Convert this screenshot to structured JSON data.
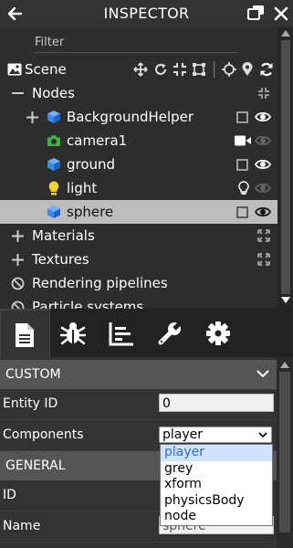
{
  "header": {
    "title": "INSPECTOR"
  },
  "tree": {
    "filter_placeholder": "Filter",
    "scene_label": "Scene",
    "nodes_label": "Nodes",
    "items": [
      {
        "label": "BackgroundHelper",
        "icon": "box-icon"
      },
      {
        "label": "camera1",
        "icon": "camera-icon"
      },
      {
        "label": "ground",
        "icon": "box-icon"
      },
      {
        "label": "light",
        "icon": "lightbulb-icon"
      },
      {
        "label": "sphere",
        "icon": "box-icon",
        "selected": true
      }
    ],
    "materials_label": "Materials",
    "textures_label": "Textures",
    "rendering_pipelines_label": "Rendering pipelines",
    "particle_systems_label": "Particle systems"
  },
  "tabs": [
    "document-icon",
    "bug-icon",
    "chart-icon",
    "wrench-icon",
    "gear-icon"
  ],
  "properties": {
    "custom_header": "CUSTOM",
    "entity_id_label": "Entity ID",
    "entity_id_value": "0",
    "components_label": "Components",
    "components_value": "player",
    "components_options": [
      "player",
      "grey",
      "xform",
      "physicsBody",
      "node"
    ],
    "general_header": "GENERAL",
    "id_label": "ID",
    "id_value_fragment": "e",
    "name_label": "Name",
    "name_value": "sphere"
  },
  "colors": {
    "accent_blue": "#3b8ae6",
    "camera_green": "#3fb042",
    "light_yellow": "#f2d22e",
    "selected_row": "#bdbdbd",
    "section_header": "#555555"
  }
}
